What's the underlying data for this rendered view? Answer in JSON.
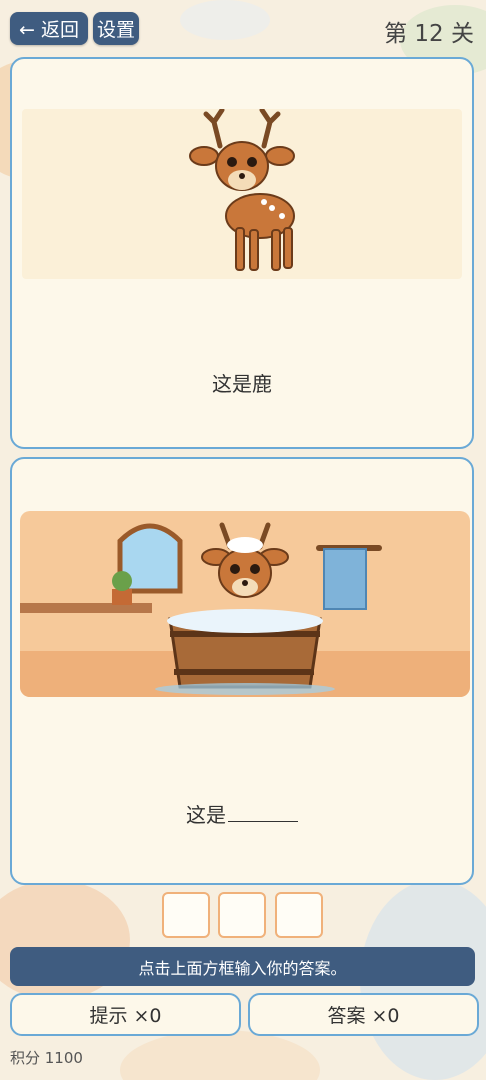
{
  "header": {
    "back_label": "← 返回",
    "settings_label": "设置",
    "level_label": "第 12 关"
  },
  "card1": {
    "image": "deer-icon",
    "caption": "这是鹿"
  },
  "card2": {
    "image": "deer-in-bathtub-icon",
    "caption_prefix": "这是"
  },
  "answer_boxes": [
    "",
    "",
    ""
  ],
  "instruction": "点击上面方框输入你的答案。",
  "buttons": {
    "hint_label": "提示 ×0",
    "answer_label": "答案 ×0"
  },
  "score_label": "积分 1100"
}
